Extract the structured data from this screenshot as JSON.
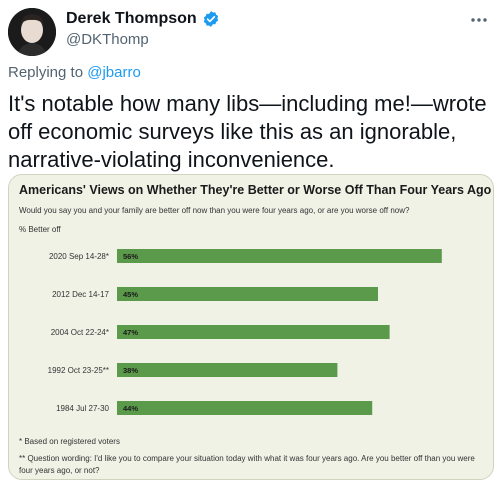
{
  "tweet": {
    "author_name": "Derek Thompson",
    "author_handle": "@DKThomp",
    "more_icon": "ellipsis-icon",
    "verified_icon": "verified-badge-icon",
    "replying_prefix": "Replying to",
    "replying_mention": "@jbarro",
    "text": "It's notable how many libs—including me!—wrote off economic surveys like this as an ignorable, narrative-violating inconvenience.",
    "colors": {
      "link": "#1d9bf0",
      "verified": "#1d9bf0",
      "bar": "#5a9a4a"
    }
  },
  "chart_data": {
    "type": "bar",
    "orientation": "horizontal",
    "title": "Americans' Views on Whether They're Better or Worse Off Than Four Years Ago",
    "subtitle": "Would you say you and your family are better off now than you were four years ago, or are you worse off now?",
    "unit_label": "% Better off",
    "categories": [
      "2020 Sep 14-28*",
      "2012 Dec 14-17",
      "2004 Oct 22-24*",
      "1992 Oct 23-25**",
      "1984 Jul 27-30"
    ],
    "values": [
      56,
      45,
      47,
      38,
      44
    ],
    "value_labels": [
      "56%",
      "45%",
      "47%",
      "38%",
      "44%"
    ],
    "xlim": [
      0,
      100
    ],
    "grid": false,
    "footnotes": [
      "* Based on registered voters",
      "** Question wording: I'd like you to compare your situation today with what it was four years ago. Are you better off than you were four years ago, or not?"
    ]
  }
}
